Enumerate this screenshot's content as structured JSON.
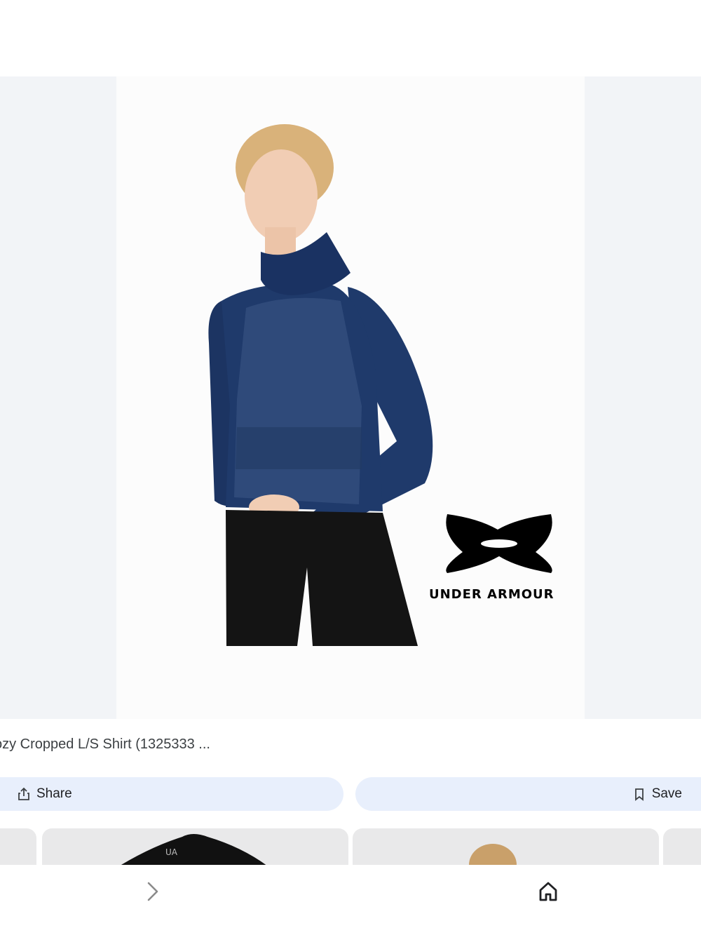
{
  "result": {
    "title": "ozy Cropped L/S Shirt (1325333 ...",
    "brand_logo_text": "UNDER ARMOUR"
  },
  "actions": {
    "share_label": "Share",
    "save_label": "Save"
  },
  "icons": {
    "share": "share-icon",
    "save": "bookmark-icon",
    "forward": "chevron-right-icon",
    "home": "home-icon"
  }
}
